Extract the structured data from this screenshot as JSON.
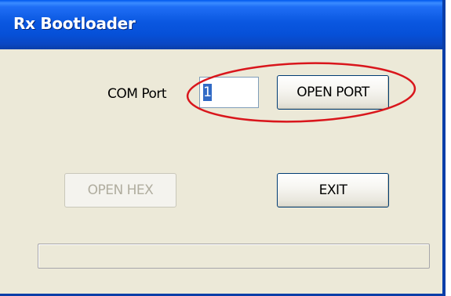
{
  "window": {
    "title": "Rx Bootloader",
    "title_color": "#0a57e0"
  },
  "com_port": {
    "label": "COM Port",
    "value": "1"
  },
  "buttons": {
    "open_port": "OPEN PORT",
    "open_hex": "OPEN HEX",
    "exit": "EXIT"
  },
  "progress": {
    "fraction": 0
  },
  "annotation": {
    "color": "#d9161c",
    "shape": "ellipse"
  }
}
